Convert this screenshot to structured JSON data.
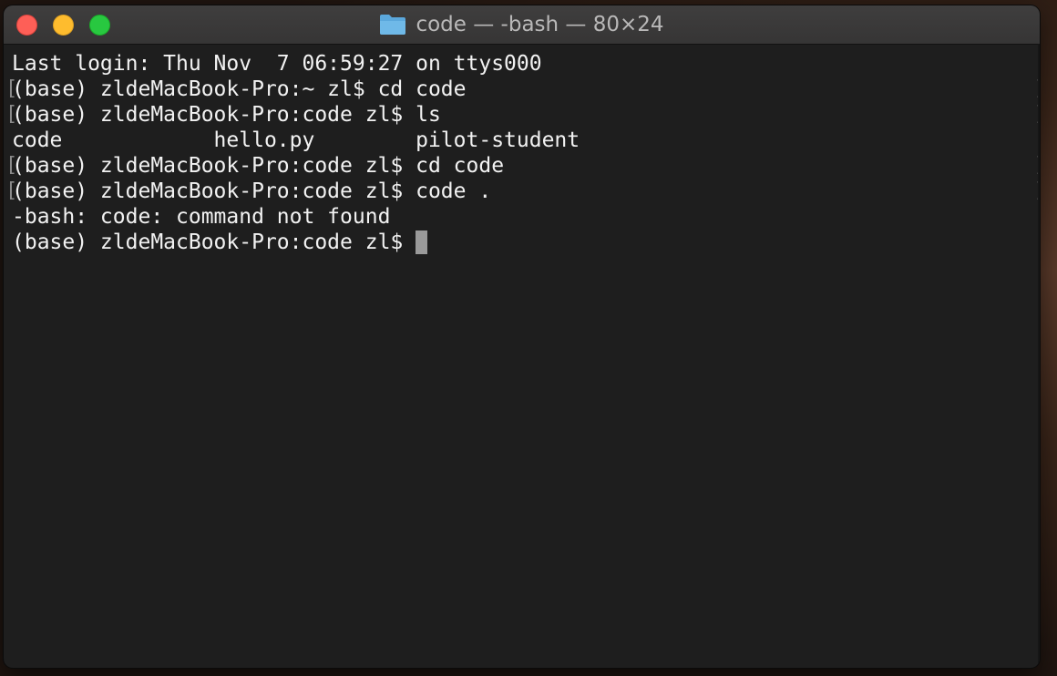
{
  "window": {
    "title": "code — -bash — 80×24",
    "title_icon": "folder-icon",
    "colors": {
      "close": "#fe5f57",
      "minimize": "#febc2e",
      "zoom": "#28c840",
      "background": "#1e1e1e",
      "text": "#f2f2f2",
      "folder": "#5ba8dc"
    }
  },
  "terminal": {
    "lines": [
      "Last login: Thu Nov  7 06:59:27 on ttys000",
      "(base) zldeMacBook-Pro:~ zl$ cd code",
      "(base) zldeMacBook-Pro:code zl$ ls",
      "code            hello.py        pilot-student",
      "(base) zldeMacBook-Pro:code zl$ cd code",
      "(base) zldeMacBook-Pro:code zl$ code .",
      "-bash: code: command not found",
      "(base) zldeMacBook-Pro:code zl$ "
    ],
    "mark_open": "[",
    "mark_close": "]"
  }
}
